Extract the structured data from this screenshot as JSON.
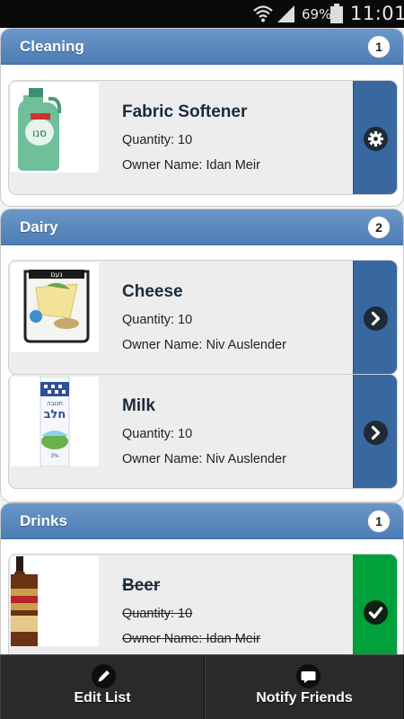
{
  "status_bar": {
    "battery": "69%",
    "time": "11:01"
  },
  "groups": [
    {
      "title": "Cleaning",
      "count": "1",
      "items": [
        {
          "name": "Fabric Softener",
          "quantity": "Quantity: 10",
          "owner": "Owner Name: Idan Meir",
          "action_icon": "gear-icon",
          "done": false
        }
      ]
    },
    {
      "title": "Dairy",
      "count": "2",
      "items": [
        {
          "name": "Cheese",
          "quantity": "Quantity: 10",
          "owner": "Owner Name: Niv Auslender",
          "action_icon": "chevron-right-icon",
          "done": false
        },
        {
          "name": "Milk",
          "quantity": "Quantity: 10",
          "owner": "Owner Name: Niv Auslender",
          "action_icon": "chevron-right-icon",
          "done": false
        }
      ]
    },
    {
      "title": "Drinks",
      "count": "1",
      "items": [
        {
          "name": "Beer",
          "quantity": "Quantity: 10",
          "owner": "Owner Name: Idan Meir",
          "action_icon": "check-icon",
          "done": true
        }
      ]
    }
  ],
  "product_labels": {
    "softener_brand": "סנו",
    "cheese_brand": "נעם",
    "milk_top": "תנובה",
    "milk_main": "חלב",
    "milk_pct": "3%"
  },
  "bottom_nav": {
    "edit_label": "Edit List",
    "notify_label": "Notify Friends"
  },
  "colors": {
    "header_blue": "#5b8ac0",
    "action_blue": "#39679f",
    "action_green": "#00a03a"
  }
}
